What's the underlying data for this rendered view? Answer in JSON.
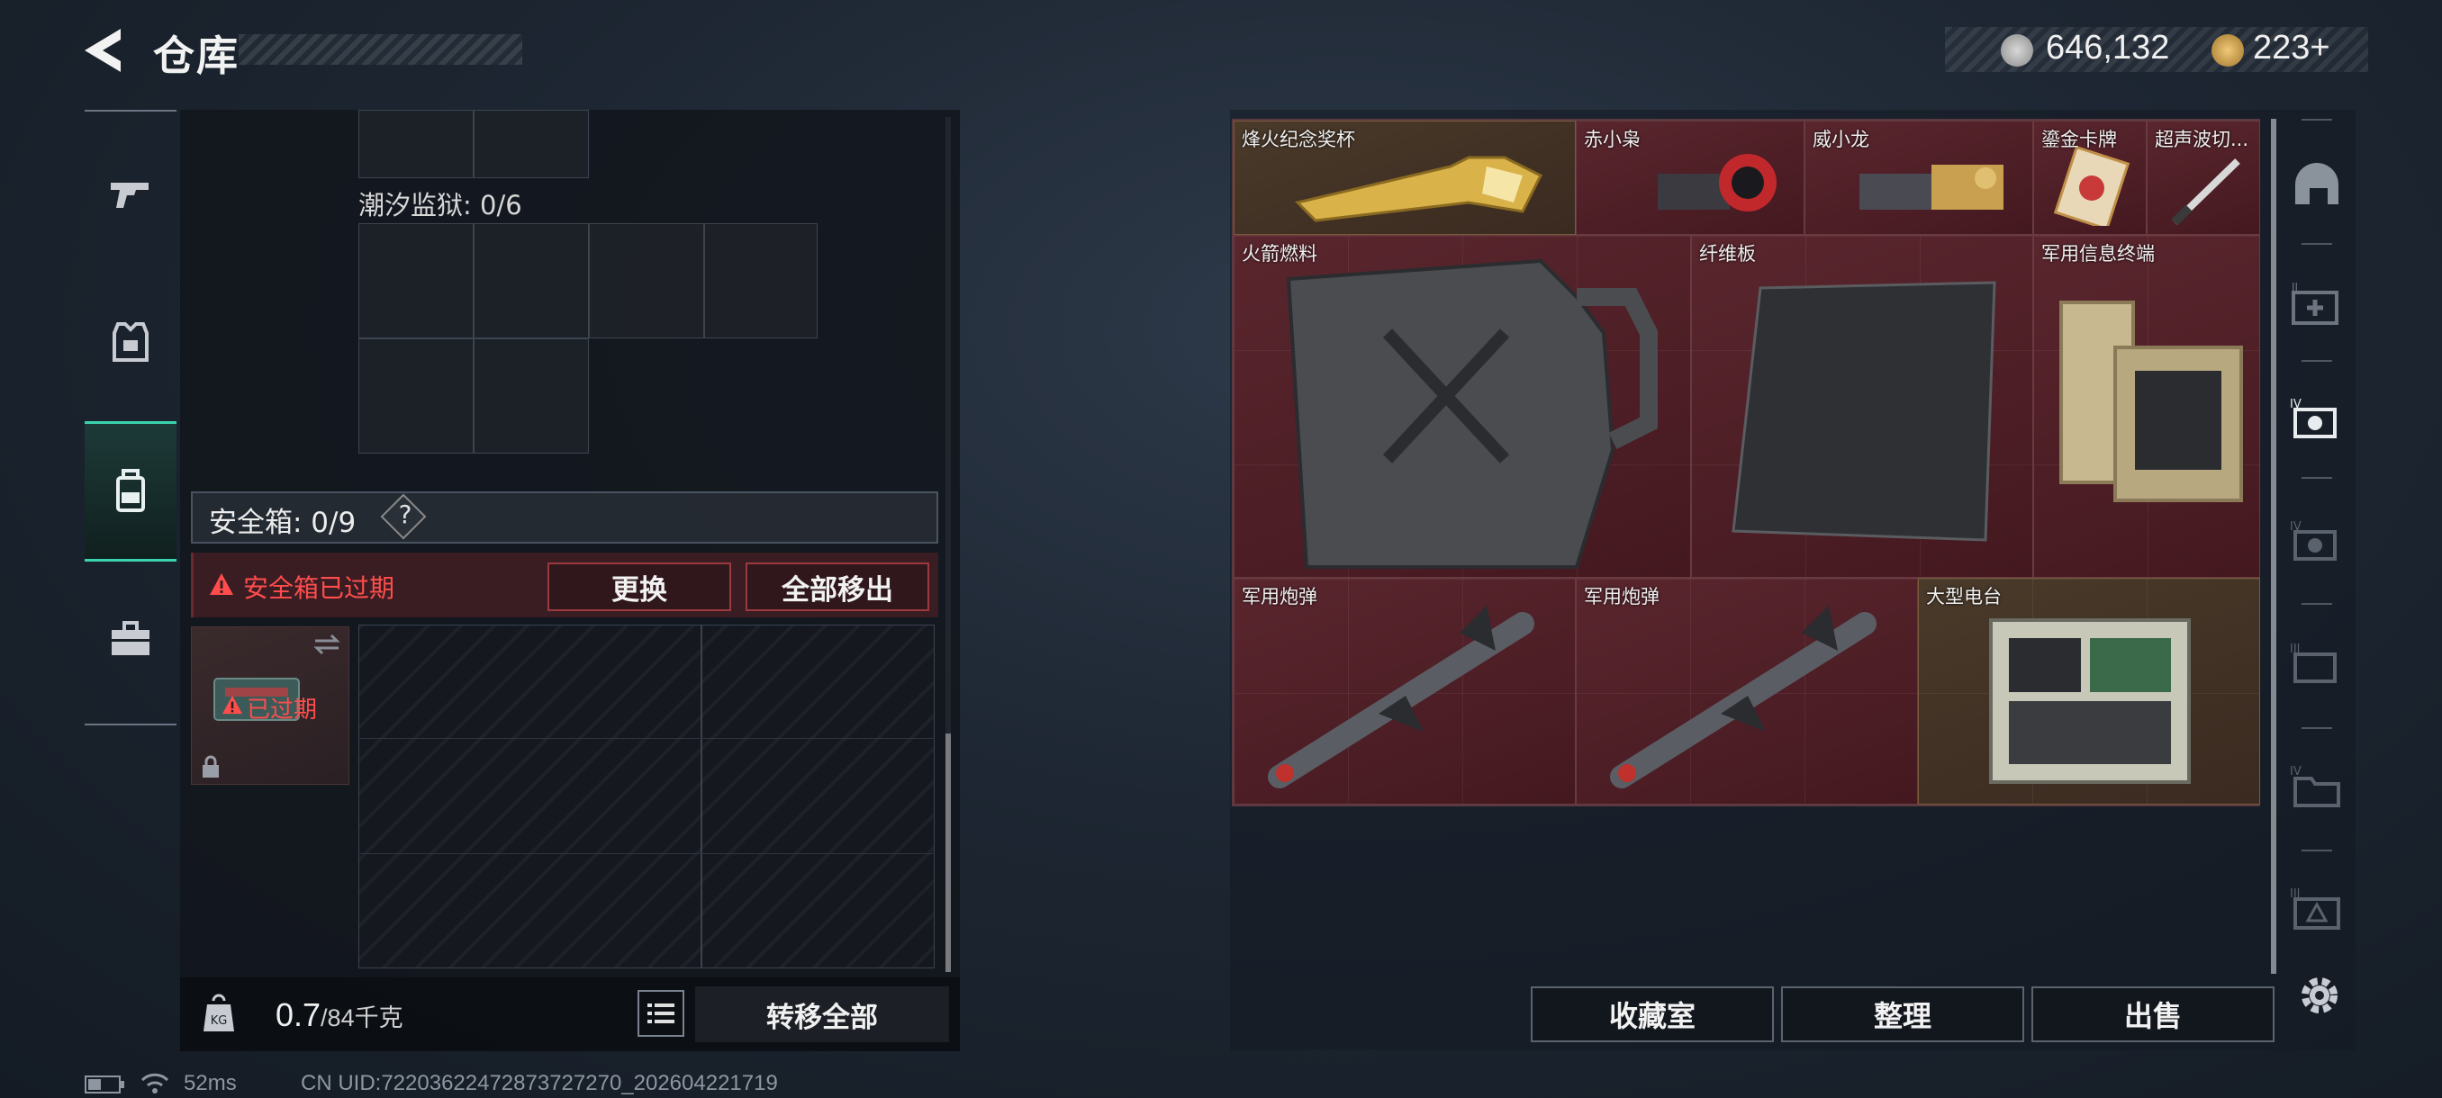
{
  "header": {
    "title": "仓库"
  },
  "currency": {
    "coins": "646,132",
    "premium": "223+"
  },
  "left_rail": {
    "items": [
      {
        "icon": "gun-icon"
      },
      {
        "icon": "armor-vest-icon"
      },
      {
        "icon": "backpack-icon"
      },
      {
        "icon": "briefcase-icon"
      }
    ],
    "active_index": 2
  },
  "left_panel": {
    "prison_label": "潮汐监狱: 0/6",
    "safe_label": "安全箱: 0/9",
    "help": "?",
    "warning": "安全箱已过期",
    "replace_button": "更换",
    "remove_all_button": "全部移出",
    "expired_badge": "已过期",
    "weight_value": "0.7",
    "weight_max": "/84千克",
    "transfer_all_button": "转移全部"
  },
  "stash": {
    "items": [
      {
        "label": "烽火纪念奖杯",
        "icon": "gold-trophy-icon"
      },
      {
        "label": "赤小枭",
        "icon": "red-owl-figure-icon"
      },
      {
        "label": "威小龙",
        "icon": "dragon-figure-icon"
      },
      {
        "label": "鎏金卡牌",
        "icon": "gilded-card-icon"
      },
      {
        "label": "超声波切...",
        "icon": "ultrasonic-cutter-icon"
      },
      {
        "label": "火箭燃料",
        "icon": "fuel-canister-icon"
      },
      {
        "label": "纤维板",
        "icon": "fiber-board-icon"
      },
      {
        "label": "军用信息终端",
        "icon": "military-terminal-icon"
      },
      {
        "label": "军用炮弹",
        "icon": "missile-icon"
      },
      {
        "label": "军用炮弹",
        "icon": "missile-icon"
      },
      {
        "label": "大型电台",
        "icon": "radio-station-icon"
      }
    ],
    "buttons": {
      "collection": "收藏室",
      "sort": "整理",
      "sell": "出售"
    }
  },
  "right_tabs": [
    {
      "icon": "helmet-icon"
    },
    {
      "icon": "tier-2-medkit-icon"
    },
    {
      "icon": "tier-4-item-icon"
    },
    {
      "icon": "tier-4-item-icon"
    },
    {
      "icon": "tier-3-item-icon"
    },
    {
      "icon": "tier-4-folder-icon"
    },
    {
      "icon": "tier-3-warning-icon"
    }
  ],
  "status_bar": {
    "ping": "52ms",
    "uid": "CN UID:7220362247287372​7270_202604221719"
  },
  "colors": {
    "accent_teal": "#3ad4b0",
    "danger_red": "#ff4d4d",
    "stash_red": "#5a262e"
  }
}
